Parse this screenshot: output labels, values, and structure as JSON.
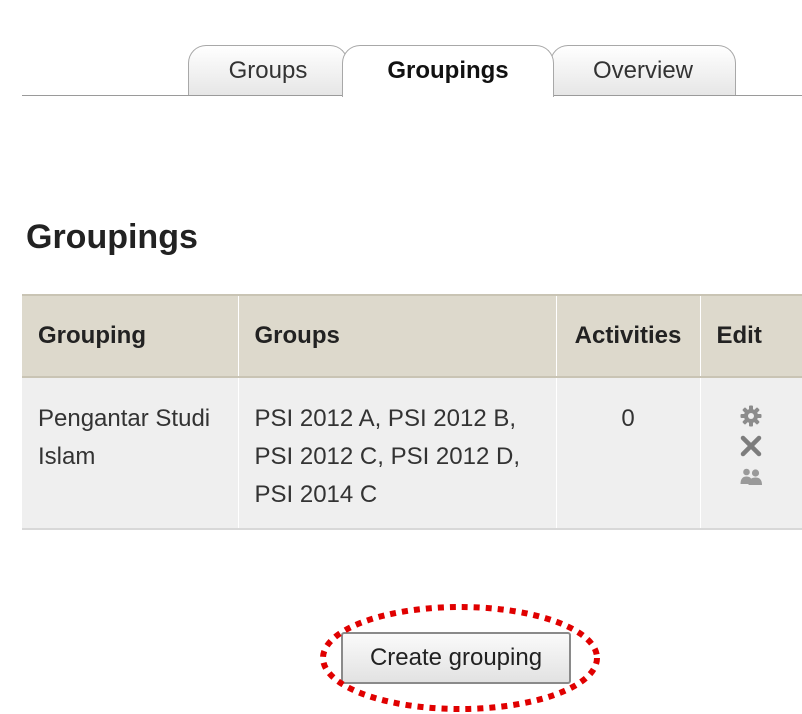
{
  "tabs": {
    "items": [
      {
        "label": "Groups"
      },
      {
        "label": "Groupings",
        "active": true
      },
      {
        "label": "Overview"
      }
    ]
  },
  "page": {
    "title": "Groupings"
  },
  "table": {
    "headers": {
      "grouping": "Grouping",
      "groups": "Groups",
      "activities": "Activities",
      "edit": "Edit"
    },
    "rows": [
      {
        "grouping": "Pengantar Studi Islam",
        "groups": "PSI 2012 A, PSI 2012 B, PSI 2012 C, PSI 2012 D, PSI 2014 C",
        "activities": "0",
        "edit_icons": [
          "gear-icon",
          "close-icon",
          "users-icon"
        ]
      }
    ]
  },
  "actions": {
    "create_grouping_label": "Create grouping"
  },
  "colors": {
    "header_bg": "#ddd9cc",
    "row_bg": "#efefef",
    "highlight": "#e00000",
    "icon": "#8c8c8c"
  }
}
